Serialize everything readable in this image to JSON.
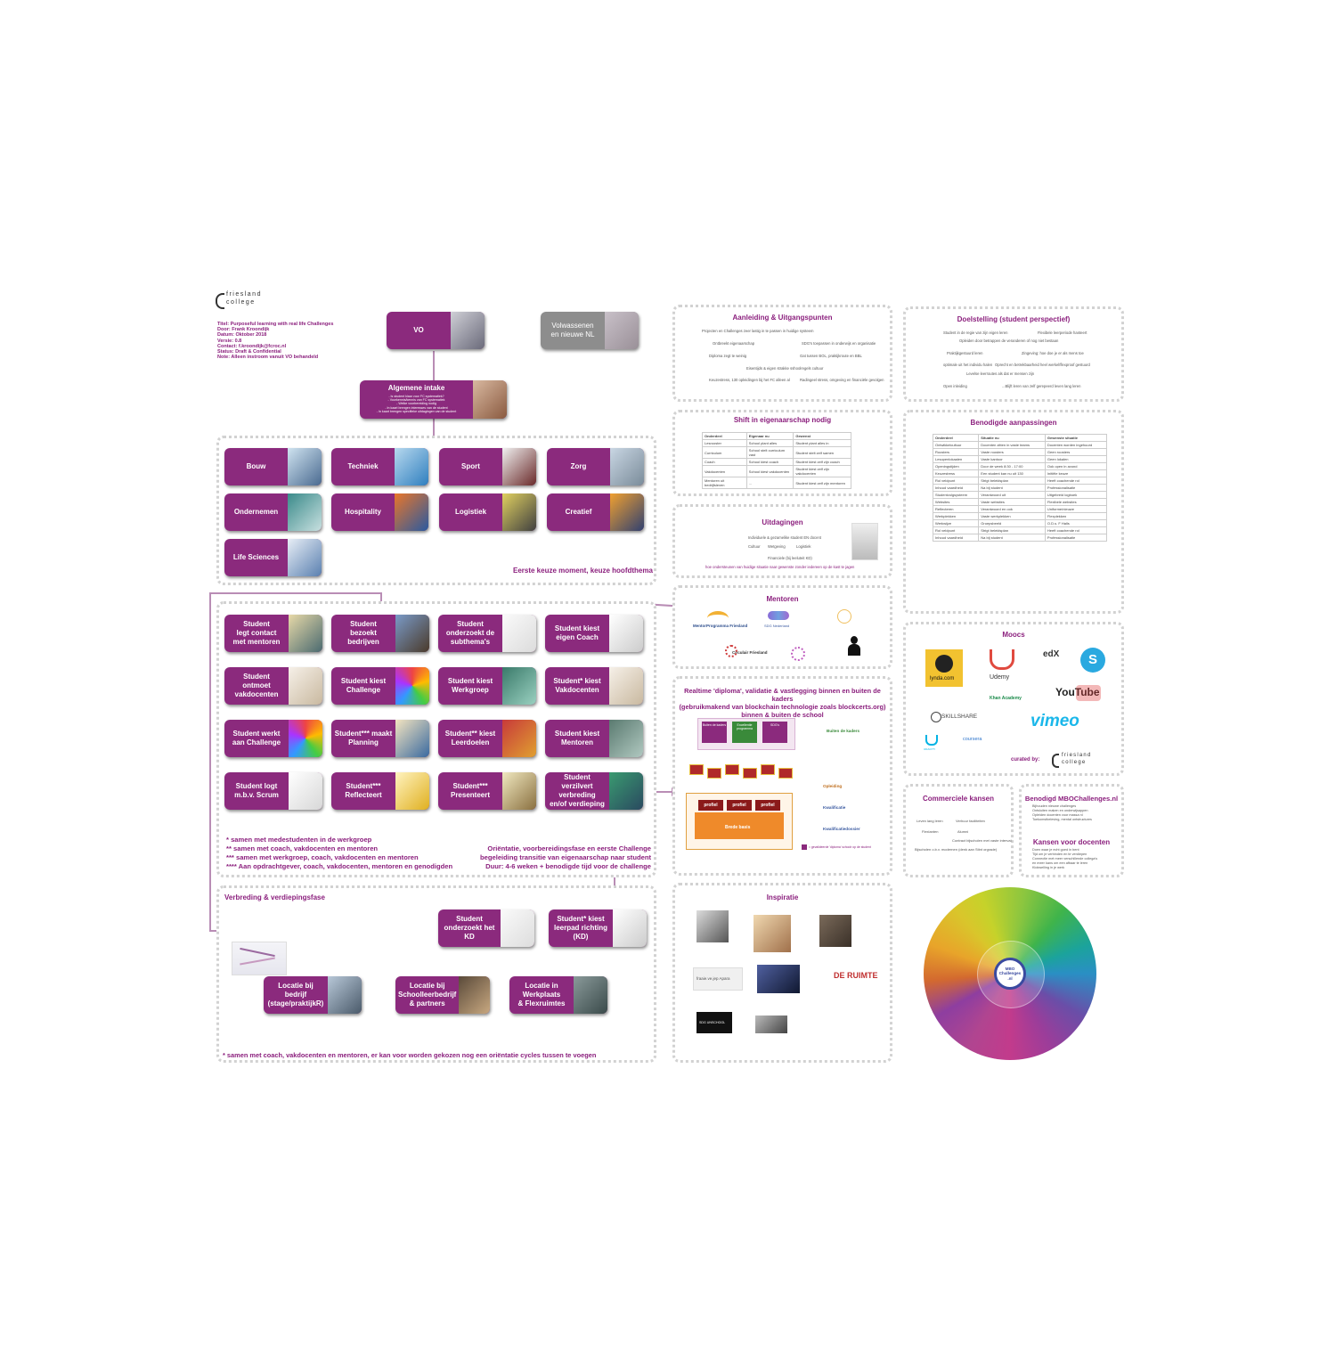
{
  "colors": {
    "primary": "#8b2a7d",
    "grey_node": "#8d8d8d",
    "line": "#b98db5",
    "dots": "#d2d2d2"
  },
  "org": {
    "line1": "friesland",
    "line2": "college"
  },
  "meta": {
    "title": "Titel: Purposeful learning with real life Challenges",
    "author": "Door: Frank Kroondijk",
    "date": "Datum: Oktober 2018",
    "version": "Versie: 0.8",
    "contact": "Contact: f.kroondijk@fcroc.nl",
    "status": "Status: Draft & Confidential",
    "note": "Note: Alleen instroom vanuit VO behandeld"
  },
  "top_nodes": {
    "vo": "VO",
    "volwassenen": "Volwassenen\nen nieuwe NL",
    "intake": "Algemene intake"
  },
  "intake_bullets": [
    "- Is student klaar voor FC systematiek?",
    "- Voorkennis/kennis van FC systematiek",
    "- Welke voorbereiding nodig",
    "- In kaart brengen interesses van de student",
    "- In kaart brengen specifieke uitdagingen van de student"
  ],
  "themes": [
    "Bouw",
    "Techniek",
    "Sport",
    "Zorg",
    "Ondernemen",
    "Hospitality",
    "Logistiek",
    "Creatief",
    "Life Sciences"
  ],
  "choice_note": "Eerste keuze moment, keuze hoofdthema",
  "flow": [
    "Student\nlegt contact\nmet mentoren",
    "Student\nbezoekt\nbedrijven",
    "Student\nonderzoekt de\nsubthema's",
    "Student kiest\neigen Coach",
    "Student\nontmoet\nvakdocenten",
    "Student kiest\nChallenge",
    "Student kiest\nWerkgroep",
    "Student* kiest\nVakdocenten",
    "Student werkt\naan Challenge",
    "Student*** maakt\nPlanning",
    "Student** kiest\nLeerdoelen",
    "Student kiest\nMentoren",
    "Student logt\nm.b.v. Scrum",
    "Student***\nReflecteert",
    "Student***\nPresenteert",
    "Student verzilvert\nverbreding\nen/of verdieping"
  ],
  "footnotes": "* samen met medestudenten in de werkgroep\n** samen met coach, vakdocenten en mentoren\n*** samen met werkgroep, coach, vakdocenten en mentoren\n**** Aan opdrachtgever, coach, vakdocenten, mentoren en genodigden",
  "orientation": "Oriëntatie, voorbereidingsfase en eerste Challenge\nbegeleiding transitie van eigenaarschap naar student\nDuur: 4-6 weken + benodigde tijd voor de challenge",
  "verbreding": {
    "title": "Verbreding & verdiepingsfase",
    "nodes": [
      "Student\nonderzoekt het\nKD",
      "Student* kiest\nleerpad richting\n(KD)",
      "Locatie bij\nbedrijf\n(stage/praktijkR)",
      "Locatie bij\nSchoolleerbedrijf\n& partners",
      "Locatie in\nWerkplaats\n& Flexruimtes"
    ],
    "footer": "* samen met coach, vakdocenten en mentoren, er kan voor worden gekozen nog een oriëntatie cycles tussen te voegen"
  },
  "panels": {
    "aanleiding": {
      "title": "Aanleiding & Uitgangspunten",
      "items": [
        "Projecten en Challenges zeer lastig in te passen in huidige systeem",
        "Ontbreekt eigenaarschap",
        "SDG's toepassen in onderwijs en organisatie",
        "Diploma zegt te weinig",
        "Gat tussen BOL, praktijkroute en BBL",
        "Eisentijds & eigen strakke sshoolregels cultuur",
        "Keuzestress, 130 opleidingen bij het FC alleen al",
        "Radingeel stress, omgeving en financiële gevolgen"
      ]
    },
    "doelstelling": {
      "title": "Doelstelling (student perspectief)",
      "items": [
        "Student in de regie van zijn eigen leren",
        "Flexibele leerperiode hanteert",
        "Opleiden door betrappen de veranderen of nog niet bestaan",
        "Praktijkgestuurd leren",
        "Zingeving: hoe doe je er als mens toe",
        "optimale uit het individu halen",
        "Oprecht en betrekbaarheid heel werkel/flexproof gestuurd",
        "Levelse leerroutes als dat er mensen zijn",
        "Open inleiding",
        "...Blijft leren van zelf gerepeerd leven lang leren"
      ]
    },
    "shift": {
      "title": "Shift in eigenaarschap nodig",
      "headers": [
        "Onderdeel",
        "Eigenaar nu",
        "Gewenst"
      ],
      "rows": [
        [
          "Lesrooster",
          "School plant alles",
          "Student plant alles in"
        ],
        [
          "Curriculum",
          "School stelt curriculum vast",
          "Student stelt zelf samen"
        ],
        [
          "Coach",
          "School kiest coach",
          "Student kiest zelf zijn coach"
        ],
        [
          "Vakdocenten",
          "School kiest vakdocenten",
          "Student kiest zelf zijn vakdocenten"
        ],
        [
          "Mentoren uit bedrijfsleven",
          "...",
          "Student kiest zelf zijn mentoren"
        ]
      ]
    },
    "benodigde": {
      "title": "Benodigde aanpassingen",
      "headers": [
        "Onderdeel",
        "Situatie nu",
        "Gewenste situatie"
      ],
      "rows": [
        [
          "Ontwikkelcultuur",
          "Docenten zitten in vaste teams",
          "Docenten worden ingehuurd"
        ],
        [
          "Roosters",
          "Vaste roosters",
          "Geen roosters"
        ],
        [
          "Lesopenlokaalen",
          "Vaste kantoor",
          "Geen lokalen"
        ],
        [
          "Openingstijden",
          "Door de week 8:30 - 17:00",
          "Ook open in avond"
        ],
        [
          "Keuzestress",
          "Een student kan nu uit 130",
          "Initiële keuze"
        ],
        [
          "Rol veldpunt",
          "Strigt beleidsplan",
          "Heeft coachende rol"
        ],
        [
          "Inhoud vaardheid",
          "Na bij student",
          "Professionalisatie"
        ],
        [
          "Studentvolgsysteem",
          "Verantwoord uit",
          "Uitgebreid logboek"
        ],
        [
          "Websites",
          "Vaste websites",
          "Flexibele websites"
        ],
        [
          "Reflecteren",
          "Verantwoord en ook",
          "Uniforme/nieuwe"
        ],
        [
          "Werkplekken",
          "Vaste werkplekken",
          "Flexplekken"
        ],
        [
          "Werkwijze",
          "Groepsbeeld",
          "O.D.s. F Halls"
        ],
        [
          "Rol veldpunt",
          "Strigt beleidsplan",
          "Heeft coachende rol"
        ],
        [
          "Inhoud vaardheid",
          "Na bij student",
          "Professionalisatie"
        ]
      ]
    },
    "uitdagingen": {
      "title": "Uitdagingen",
      "items": [
        "Individuele & gezamelike student EN docent",
        "Cultuur",
        "Wetgeving",
        "Logistiek",
        "Financiele (bij leeluteit KD)"
      ],
      "question": "hoe ondersteunen van huidige situatie naar gewenste zonder iedereen op de kast te jagen"
    },
    "mentoren": {
      "title": "Mentoren",
      "logos": [
        "MentorProgramma Friesland",
        "SDG Nederland",
        "Circulair Friesland"
      ]
    },
    "realtime": {
      "title": "Realtime 'diploma', validatie & vastlegging binnen en buiten de kaders\n(gebruikmakend van blockchain technologie zoals blockcerts.org)\nbinnen & buiten de school",
      "boxes": [
        "Buiten de kaders",
        "Excellentie programma",
        "SDG's"
      ],
      "labels": [
        "Buiten de kaders",
        "Opleiding",
        "Kwalificatie",
        "Kwalificatiedossier"
      ],
      "profiel": [
        "profiel",
        "profiel",
        "profiel"
      ],
      "brede": "Brede basis",
      "legend": "= gevalideerde 'diploma' schoolr op de student"
    },
    "moocs": {
      "title": "Moocs",
      "logos": [
        "lynda.com",
        "Udemy",
        "edX",
        "Khan Academy",
        "YouTube",
        "SKILLSHARE",
        "vimeo",
        "coursera",
        "UDACITY"
      ],
      "curated": "curated by:"
    },
    "commercieel": {
      "title": "Commerciele kansen",
      "items": [
        "Leven lang leren",
        "Verhuur faciliteiten",
        "Flexlanten",
        "Alumni",
        "Contract bijscholen met vaste interval",
        "Bijscholen o.b.v. modernen (denk aan Stint orgrade)"
      ]
    },
    "mbochallenges": {
      "title": "Benodigd MBOChallenges.nl",
      "items": [
        "Bijhouden nieuwe challenges",
        "Ontsluiten maken en onderwijsappen",
        "Opleiden docenten voor massa nl",
        "Toekomstbeleving, mental ontstructures"
      ]
    },
    "docenten": {
      "title": "Kansen voor docenten",
      "items": [
        "Doen waar je echt goed in bent",
        "Tijd om je verbinden en te verdiepen",
        "Connectie met meer verschillende collega's",
        "en meer kans om een afbaar te leren",
        "Klokwelling in je werk"
      ]
    },
    "inspiratie": {
      "title": "Inspiratie",
      "items": [
        "fraaie.ve.jep Apara",
        "DE RUIMTE",
        "SDG UNSCHOOL"
      ]
    },
    "wheel": {
      "center": "MBO\nChallenges\n.nl"
    }
  }
}
